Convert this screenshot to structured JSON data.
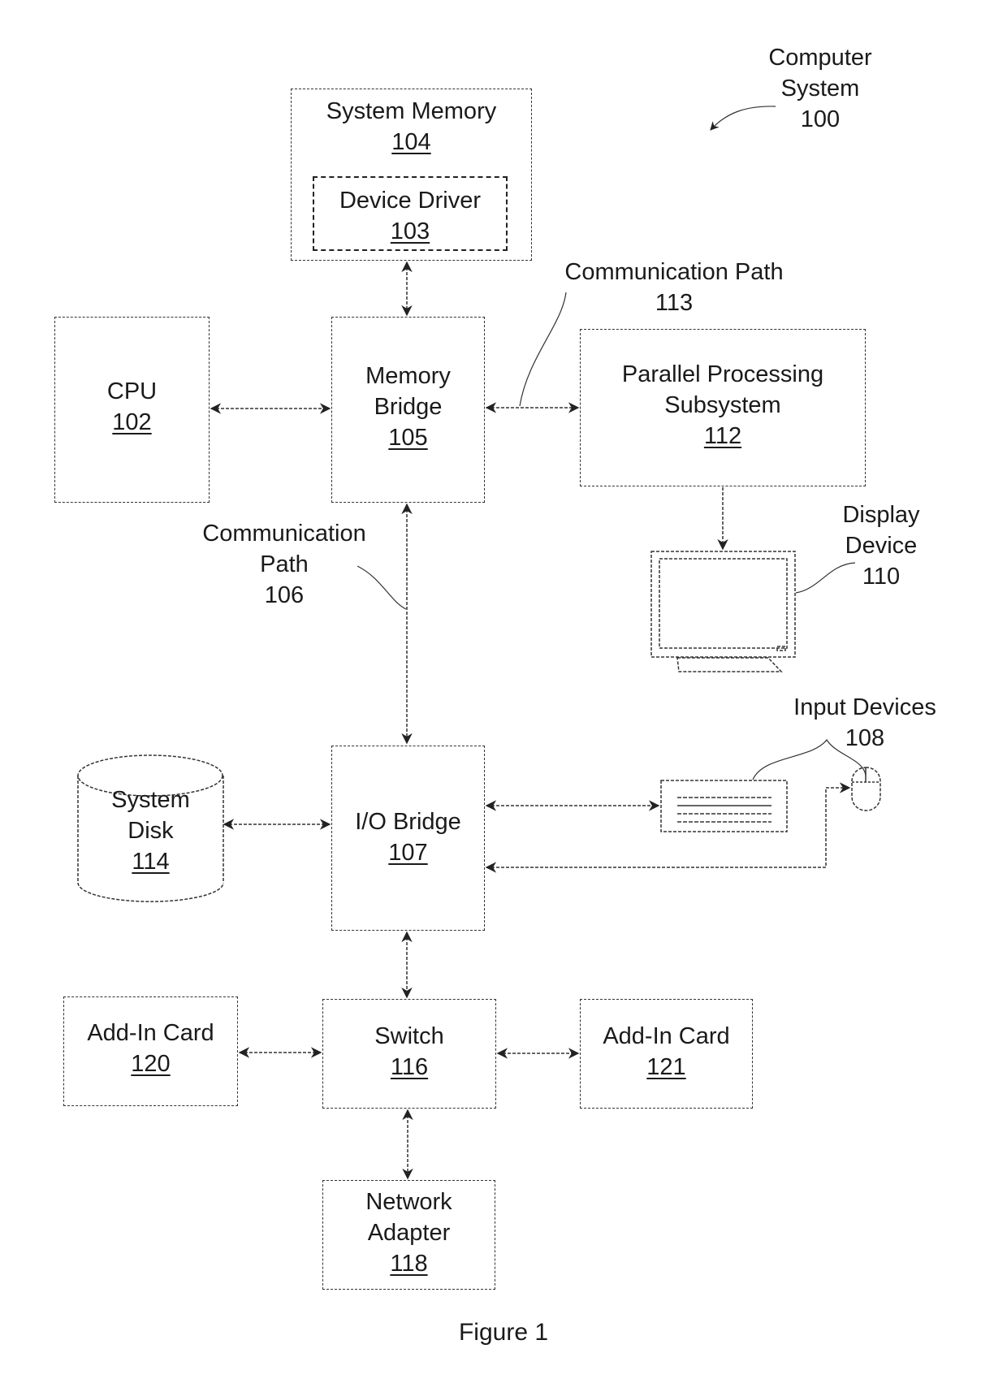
{
  "figure": {
    "caption": "Figure 1",
    "system_title": {
      "line1": "Computer",
      "line2": "System",
      "ref": "100"
    }
  },
  "blocks": {
    "system_memory": {
      "name": "System Memory",
      "ref": "104"
    },
    "device_driver": {
      "name": "Device Driver",
      "ref": "103"
    },
    "cpu": {
      "name": "CPU",
      "ref": "102"
    },
    "memory_bridge": {
      "line1": "Memory",
      "line2": "Bridge",
      "ref": "105"
    },
    "parallel_processing": {
      "line1": "Parallel Processing",
      "line2": "Subsystem",
      "ref": "112"
    },
    "display_device": {
      "line1": "Display",
      "line2": "Device",
      "ref": "110"
    },
    "io_bridge": {
      "name": "I/O Bridge",
      "ref": "107"
    },
    "system_disk": {
      "line1": "System",
      "line2": "Disk",
      "ref": "114"
    },
    "input_devices": {
      "name": "Input Devices",
      "ref": "108"
    },
    "switch": {
      "name": "Switch",
      "ref": "116"
    },
    "add_in_card_120": {
      "name": "Add-In Card",
      "ref": "120"
    },
    "add_in_card_121": {
      "name": "Add-In Card",
      "ref": "121"
    },
    "network_adapter": {
      "line1": "Network",
      "line2": "Adapter",
      "ref": "118"
    }
  },
  "callouts": {
    "comm_path_113": {
      "line1": "Communication Path",
      "ref": "113"
    },
    "comm_path_106": {
      "line1": "Communication",
      "line2": "Path",
      "ref": "106"
    }
  },
  "connections": [
    {
      "from": "system_memory",
      "to": "memory_bridge",
      "direction": "bidirectional"
    },
    {
      "from": "cpu",
      "to": "memory_bridge",
      "direction": "bidirectional"
    },
    {
      "from": "memory_bridge",
      "to": "parallel_processing",
      "direction": "bidirectional"
    },
    {
      "from": "parallel_processing",
      "to": "display_device",
      "direction": "to"
    },
    {
      "from": "memory_bridge",
      "to": "io_bridge",
      "direction": "bidirectional"
    },
    {
      "from": "system_disk",
      "to": "io_bridge",
      "direction": "bidirectional"
    },
    {
      "from": "io_bridge",
      "to": "keyboard",
      "direction": "bidirectional"
    },
    {
      "from": "io_bridge",
      "to": "mouse",
      "direction": "bidirectional"
    },
    {
      "from": "io_bridge",
      "to": "switch",
      "direction": "bidirectional"
    },
    {
      "from": "add_in_card_120",
      "to": "switch",
      "direction": "bidirectional"
    },
    {
      "from": "switch",
      "to": "add_in_card_121",
      "direction": "bidirectional"
    },
    {
      "from": "switch",
      "to": "network_adapter",
      "direction": "bidirectional"
    }
  ]
}
